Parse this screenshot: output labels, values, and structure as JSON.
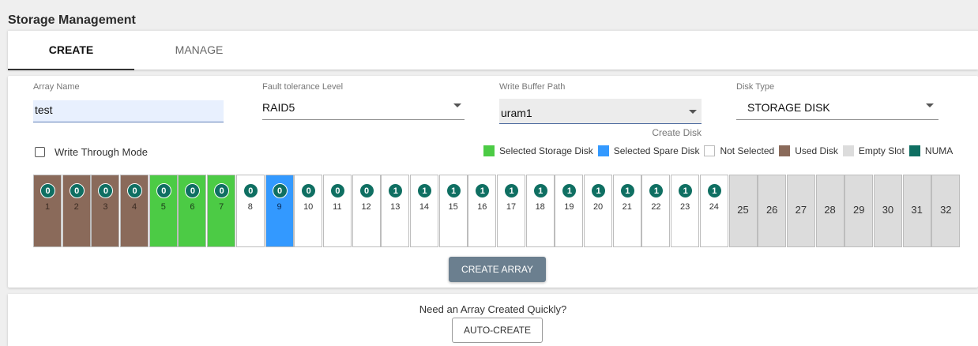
{
  "page": {
    "title": "Storage Management"
  },
  "tabs": [
    {
      "label": "CREATE",
      "active": true
    },
    {
      "label": "MANAGE",
      "active": false
    }
  ],
  "form": {
    "array_name": {
      "label": "Array Name",
      "value": "test"
    },
    "fault_tolerance": {
      "label": "Fault tolerance Level",
      "value": "RAID5"
    },
    "write_buffer": {
      "label": "Write Buffer Path",
      "value": "uram1",
      "link": "Create Disk"
    },
    "disk_type": {
      "label": "Disk Type",
      "value": "STORAGE DISK"
    },
    "write_through": {
      "label": "Write Through Mode",
      "checked": false
    }
  },
  "legend": [
    {
      "label": "Selected Storage Disk",
      "color": "#4ccb45"
    },
    {
      "label": "Selected Spare Disk",
      "color": "#3399ff"
    },
    {
      "label": "Not Selected",
      "color": "#ffffff"
    },
    {
      "label": "Used Disk",
      "color": "#8a6a5a"
    },
    {
      "label": "Empty Slot",
      "color": "#dcdcdc"
    },
    {
      "label": "NUMA",
      "color": "#0f6f62"
    }
  ],
  "slots": [
    {
      "number": "1",
      "numa": "0",
      "state": "used"
    },
    {
      "number": "2",
      "numa": "0",
      "state": "used"
    },
    {
      "number": "3",
      "numa": "0",
      "state": "used"
    },
    {
      "number": "4",
      "numa": "0",
      "state": "used"
    },
    {
      "number": "5",
      "numa": "0",
      "state": "storage"
    },
    {
      "number": "6",
      "numa": "0",
      "state": "storage"
    },
    {
      "number": "7",
      "numa": "0",
      "state": "storage"
    },
    {
      "number": "8",
      "numa": "0",
      "state": "free"
    },
    {
      "number": "9",
      "numa": "0",
      "state": "spare"
    },
    {
      "number": "10",
      "numa": "0",
      "state": "free"
    },
    {
      "number": "11",
      "numa": "0",
      "state": "free"
    },
    {
      "number": "12",
      "numa": "0",
      "state": "free"
    },
    {
      "number": "13",
      "numa": "1",
      "state": "free"
    },
    {
      "number": "14",
      "numa": "1",
      "state": "free"
    },
    {
      "number": "15",
      "numa": "1",
      "state": "free"
    },
    {
      "number": "16",
      "numa": "1",
      "state": "free"
    },
    {
      "number": "17",
      "numa": "1",
      "state": "free"
    },
    {
      "number": "18",
      "numa": "1",
      "state": "free"
    },
    {
      "number": "19",
      "numa": "1",
      "state": "free"
    },
    {
      "number": "20",
      "numa": "1",
      "state": "free"
    },
    {
      "number": "21",
      "numa": "1",
      "state": "free"
    },
    {
      "number": "22",
      "numa": "1",
      "state": "free"
    },
    {
      "number": "23",
      "numa": "1",
      "state": "free"
    },
    {
      "number": "24",
      "numa": "1",
      "state": "free"
    },
    {
      "number": "25",
      "numa": "",
      "state": "empty"
    },
    {
      "number": "26",
      "numa": "",
      "state": "empty"
    },
    {
      "number": "27",
      "numa": "",
      "state": "empty"
    },
    {
      "number": "28",
      "numa": "",
      "state": "empty"
    },
    {
      "number": "29",
      "numa": "",
      "state": "empty"
    },
    {
      "number": "30",
      "numa": "",
      "state": "empty"
    },
    {
      "number": "31",
      "numa": "",
      "state": "empty"
    },
    {
      "number": "32",
      "numa": "",
      "state": "empty"
    }
  ],
  "slot_colors": {
    "used": "#8a6a5a",
    "storage": "#4ccb45",
    "spare": "#3399ff",
    "free": "#ffffff",
    "empty": "#dcdcdc"
  },
  "actions": {
    "create_array": "CREATE ARRAY"
  },
  "quick": {
    "prompt": "Need an Array Created Quickly?",
    "button": "AUTO-CREATE"
  }
}
